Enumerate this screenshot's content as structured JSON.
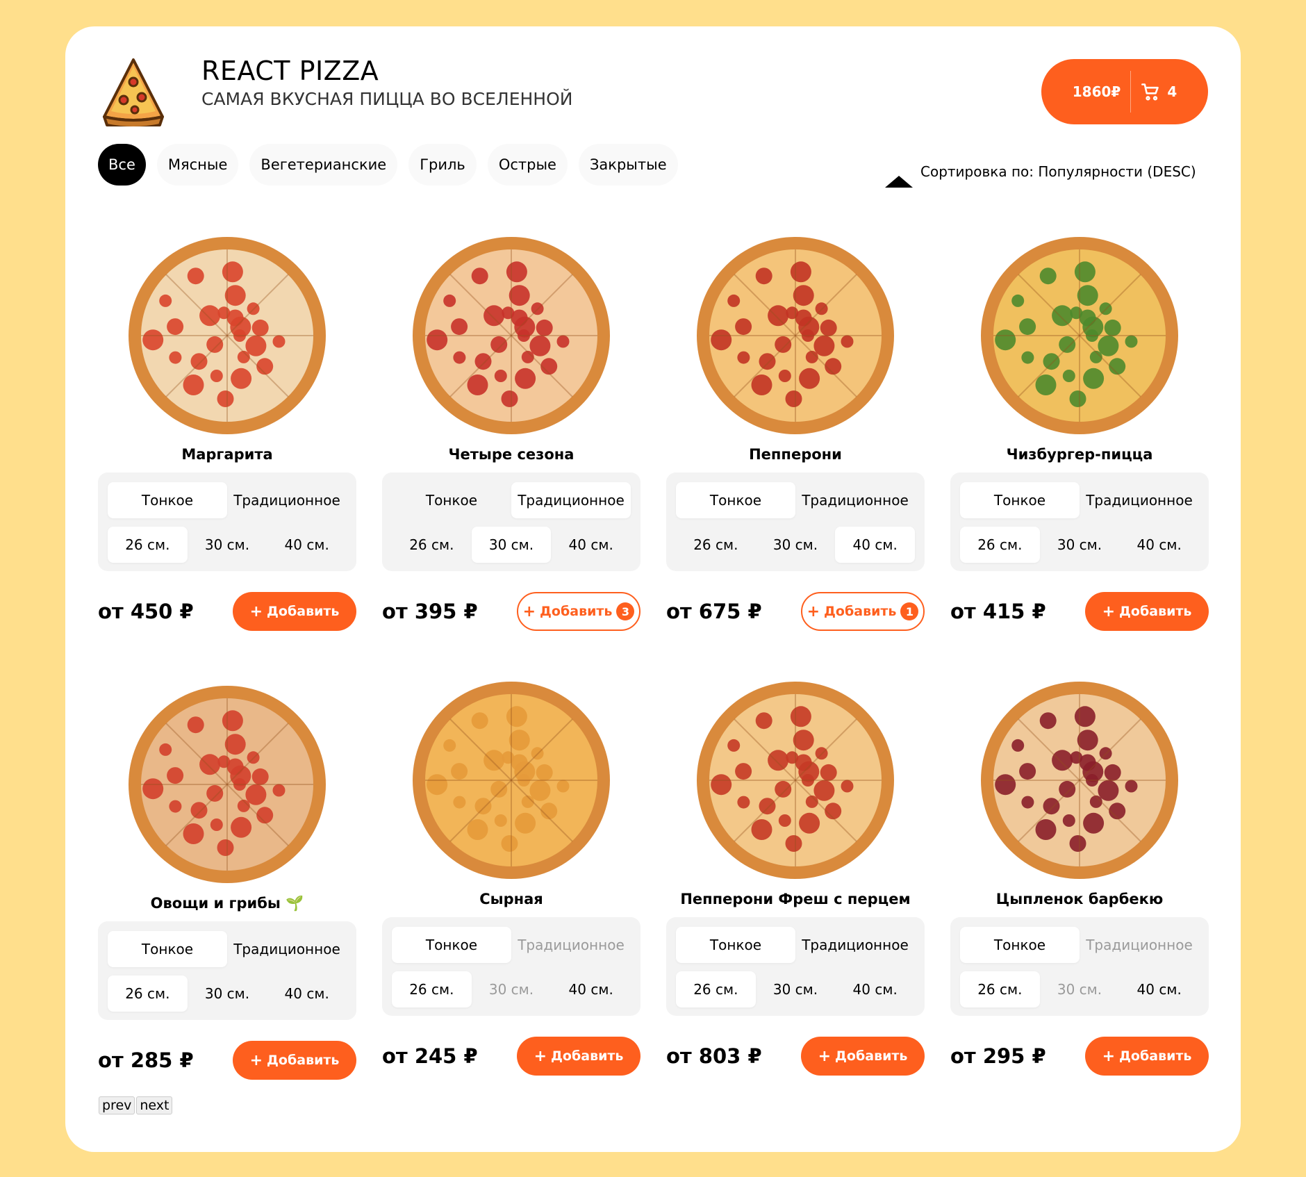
{
  "header": {
    "title": "REACT PIZZA",
    "subtitle": "САМАЯ ВКУСНАЯ ПИЦЦА ВО ВСЕЛЕННОЙ",
    "cart_total": "1860₽",
    "cart_count": "4"
  },
  "categories": [
    "Все",
    "Мясные",
    "Вегетерианские",
    "Гриль",
    "Острые",
    "Закрытые"
  ],
  "active_category": "Все",
  "sort": {
    "label": "Сортировка по: Популярности (DESC)"
  },
  "pizzas": [
    {
      "name": "Маргарита",
      "dough": [
        "Тонкое",
        "Традиционное"
      ],
      "sizes": [
        "26 см.",
        "30 см.",
        "40 см."
      ],
      "price": "от 450 ₽",
      "add_label": "Добавить",
      "count": ""
    },
    {
      "name": "Четыре сезона",
      "dough": [
        "Тонкое",
        "Традиционное"
      ],
      "sizes": [
        "26 см.",
        "30 см.",
        "40 см."
      ],
      "price": "от 395 ₽",
      "add_label": "Добавить",
      "count": "3"
    },
    {
      "name": "Пепперони",
      "dough": [
        "Тонкое",
        "Традиционное"
      ],
      "sizes": [
        "26 см.",
        "30 см.",
        "40 см."
      ],
      "price": "от 675 ₽",
      "add_label": "Добавить",
      "count": "1"
    },
    {
      "name": "Чизбургер-пицца",
      "dough": [
        "Тонкое",
        "Традиционное"
      ],
      "sizes": [
        "26 см.",
        "30 см.",
        "40 см."
      ],
      "price": "от 415 ₽",
      "add_label": "Добавить",
      "count": ""
    },
    {
      "name": "Овощи и грибы 🌱",
      "dough": [
        "Тонкое",
        "Традиционное"
      ],
      "sizes": [
        "26 см.",
        "30 см.",
        "40 см."
      ],
      "price": "от 285 ₽",
      "add_label": "Добавить",
      "count": ""
    },
    {
      "name": "Сырная",
      "dough": [
        "Тонкое",
        "Традиционное"
      ],
      "sizes": [
        "26 см.",
        "30 см.",
        "40 см."
      ],
      "price": "от 245 ₽",
      "add_label": "Добавить",
      "count": ""
    },
    {
      "name": "Пепперони Фреш с перцем",
      "dough": [
        "Тонкое",
        "Традиционное"
      ],
      "sizes": [
        "26 см.",
        "30 см.",
        "40 см."
      ],
      "price": "от 803 ₽",
      "add_label": "Добавить",
      "count": ""
    },
    {
      "name": "Цыпленок барбекю",
      "dough": [
        "Тонкое",
        "Традиционное"
      ],
      "sizes": [
        "26 см.",
        "30 см.",
        "40 см."
      ],
      "price": "от 295 ₽",
      "add_label": "Добавить",
      "count": ""
    }
  ],
  "pagination": {
    "prev": "prev",
    "next": "next"
  },
  "colors": {
    "accent": "#fe5f1e",
    "background": "#ffdf8c"
  }
}
